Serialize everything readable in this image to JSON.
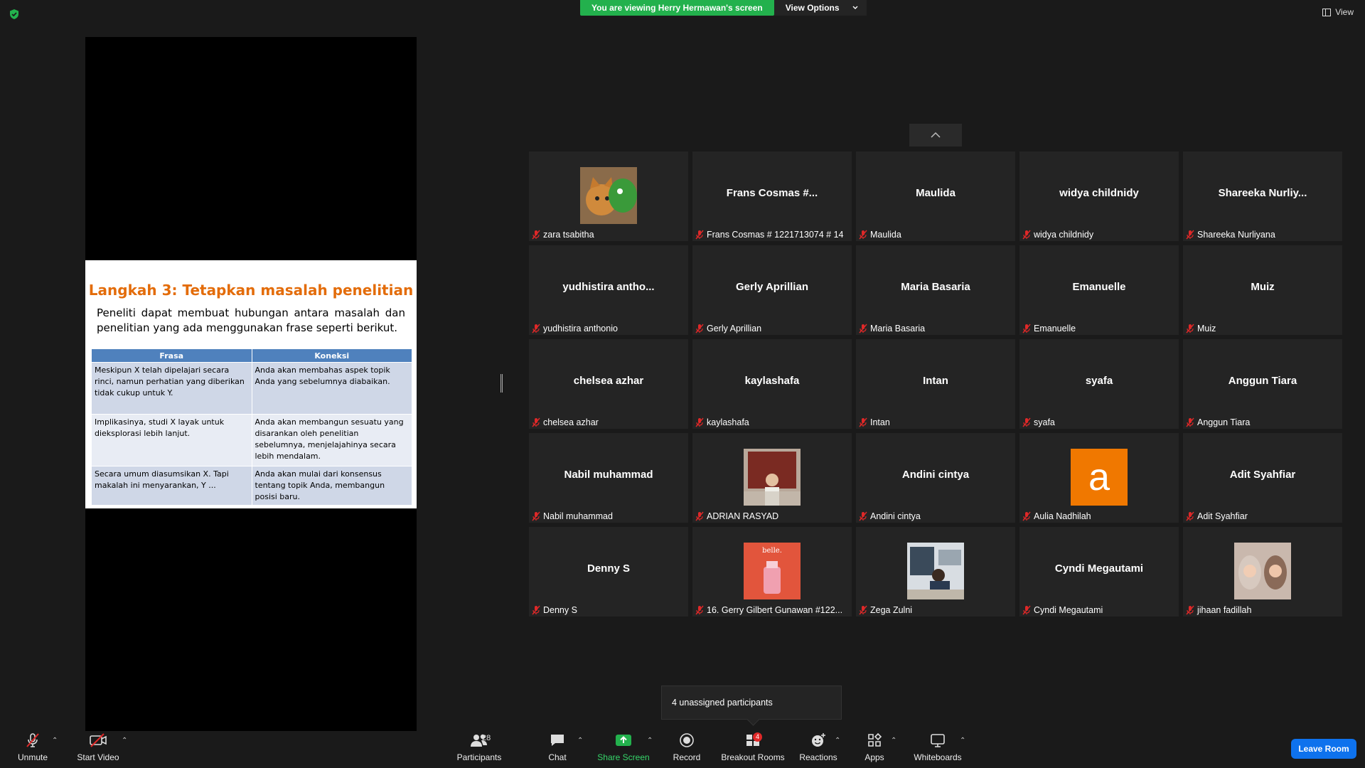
{
  "banner": {
    "viewing_text": "You are viewing Herry Hermawan's screen",
    "view_options": "View Options"
  },
  "view_button": "View",
  "slide": {
    "title": "Langkah 3: Tetapkan masalah penelitian",
    "body": "Peneliti dapat membuat hubungan antara masalah dan penelitian yang ada menggunakan frase seperti berikut.",
    "headers": [
      "Frasa",
      "Koneksi"
    ],
    "rows": [
      [
        "Meskipun X telah dipelajari secara rinci, namun perhatian yang diberikan tidak cukup untuk Y.",
        "Anda akan membahas aspek topik Anda yang sebelumnya diabaikan."
      ],
      [
        "Implikasinya, studi X layak untuk dieksplorasi lebih lanjut.",
        "Anda akan membangun sesuatu yang disarankan oleh penelitian sebelumnya, menjelajahinya secara lebih mendalam."
      ],
      [
        "Secara umum diasumsikan X. Tapi makalah ini menyarankan, Y ...",
        "Anda akan mulai dari konsensus tentang topik Anda, membangun posisi baru."
      ]
    ]
  },
  "participants": [
    {
      "big": "",
      "label": "zara tsabitha",
      "avatar": "cat"
    },
    {
      "big": "Frans Cosmas #...",
      "label": "Frans Cosmas # 1221713074 # 14"
    },
    {
      "big": "Maulida",
      "label": "Maulida"
    },
    {
      "big": "widya childnidy",
      "label": "widya childnidy"
    },
    {
      "big": "Shareeka  Nurliy...",
      "label": "Shareeka Nurliyana"
    },
    {
      "big": "yudhistira  antho...",
      "label": "yudhistira anthonio"
    },
    {
      "big": "Gerly Aprillian",
      "label": "Gerly Aprillian"
    },
    {
      "big": "Maria Basaria",
      "label": "Maria Basaria"
    },
    {
      "big": "Emanuelle",
      "label": "Emanuelle"
    },
    {
      "big": "Muiz",
      "label": "Muiz"
    },
    {
      "big": "chelsea azhar",
      "label": "chelsea azhar"
    },
    {
      "big": "kaylashafa",
      "label": "kaylashafa"
    },
    {
      "big": "Intan",
      "label": "Intan"
    },
    {
      "big": "syafa",
      "label": "syafa"
    },
    {
      "big": "Anggun Tiara",
      "label": "Anggun Tiara"
    },
    {
      "big": "Nabil muhammad",
      "label": "Nabil muhammad"
    },
    {
      "big": "",
      "label": "ADRIAN RASYAD",
      "avatar": "photo-red"
    },
    {
      "big": "Andini cintya",
      "label": "Andini cintya"
    },
    {
      "big": "",
      "label": "Aulia Nadhilah",
      "avatar": "letter",
      "letter": "a"
    },
    {
      "big": "Adit Syahfiar",
      "label": "Adit Syahfiar"
    },
    {
      "big": "Denny S",
      "label": "Denny S"
    },
    {
      "big": "",
      "label": "16. Gerry Gilbert Gunawan #122...",
      "avatar": "belle",
      "avatar_text": "belle."
    },
    {
      "big": "",
      "label": "Zega Zulni",
      "avatar": "photo-office"
    },
    {
      "big": "Cyndi Megautami",
      "label": "Cyndi Megautami"
    },
    {
      "big": "",
      "label": "jihaan fadillah",
      "avatar": "photo-duo"
    }
  ],
  "tooltip": "4 unassigned participants",
  "toolbar": {
    "unmute": "Unmute",
    "start_video": "Start Video",
    "participants": "Participants",
    "participants_count": "28",
    "chat": "Chat",
    "share_screen": "Share Screen",
    "record": "Record",
    "breakout_rooms": "Breakout Rooms",
    "breakout_badge": "4",
    "reactions": "Reactions",
    "apps": "Apps",
    "whiteboards": "Whiteboards",
    "leave": "Leave Room"
  },
  "colors": {
    "share_green": "#23b14d",
    "leave_blue": "#0e72ed",
    "slide_title": "#e36c0a",
    "table_header": "#4f81bd"
  }
}
